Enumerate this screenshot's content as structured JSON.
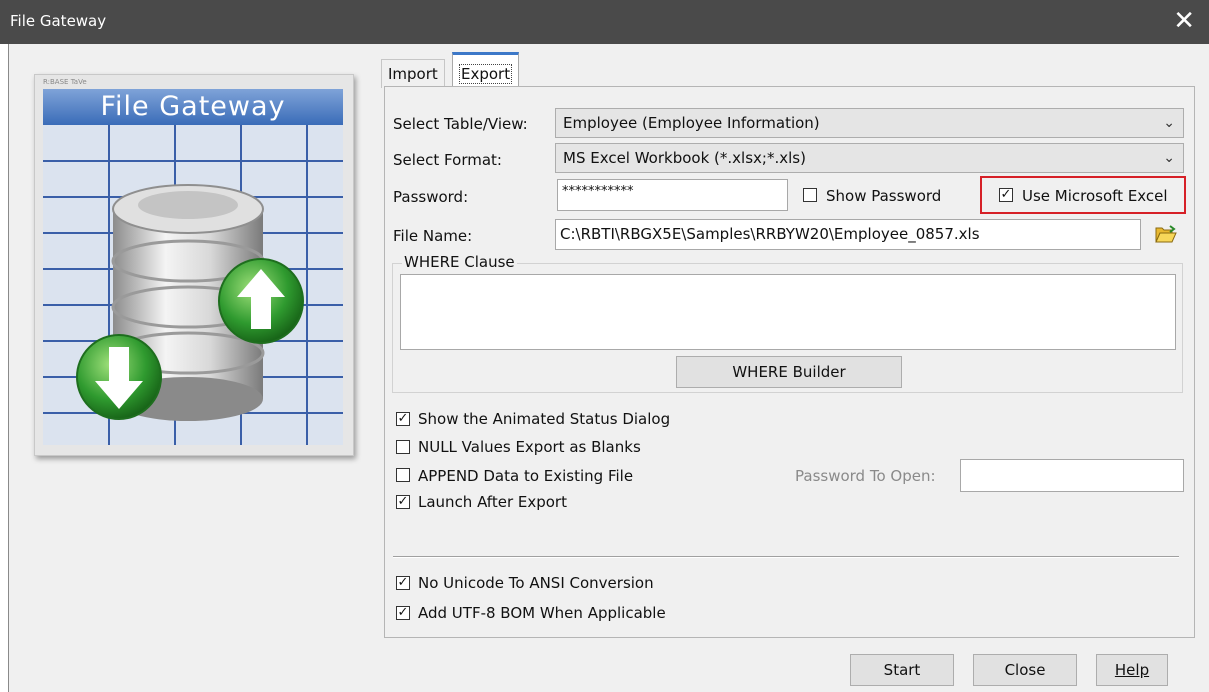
{
  "window": {
    "title": "File Gateway",
    "close_glyph": "✕"
  },
  "logo": {
    "small_text": "R:BASE TaVe",
    "banner": "File Gateway"
  },
  "tabs": [
    {
      "label": "Import"
    },
    {
      "label": "Export"
    }
  ],
  "form": {
    "table_label": "Select Table/View:",
    "table_value": "Employee  (Employee Information)",
    "format_label": "Select Format:",
    "format_value": "MS Excel Workbook (*.xlsx;*.xls)",
    "password_label": "Password:",
    "password_value": "***********",
    "show_password_label": "Show Password",
    "show_password_checked": false,
    "use_excel_label": "Use Microsoft Excel",
    "use_excel_checked": true,
    "filename_label": "File Name:",
    "filename_value": "C:\\RBTI\\RBGX5E\\Samples\\RRBYW20\\Employee_0857.xls",
    "where_label": "WHERE Clause",
    "where_value": "",
    "where_builder_label": "WHERE Builder"
  },
  "options": [
    {
      "label": "Show the Animated Status Dialog",
      "checked": true
    },
    {
      "label": "NULL Values Export as Blanks",
      "checked": false
    },
    {
      "label": "APPEND Data to Existing File",
      "checked": false
    },
    {
      "label": "Launch After Export",
      "checked": true
    }
  ],
  "password_to_open": {
    "label": "Password To Open:",
    "value": ""
  },
  "encoding": [
    {
      "label": "No Unicode To ANSI Conversion",
      "checked": true
    },
    {
      "label": "Add UTF-8 BOM When Applicable",
      "checked": true
    }
  ],
  "buttons": {
    "start": "Start",
    "close": "Close",
    "help": "Help"
  },
  "colors": {
    "titlebar": "#4a4a4a",
    "highlight_border": "#d62027",
    "tab_accent": "#3c78c8"
  },
  "icons": {
    "folder": "folder-open-icon",
    "upload_arrow": "arrow-up-icon",
    "download_arrow": "arrow-down-icon"
  }
}
